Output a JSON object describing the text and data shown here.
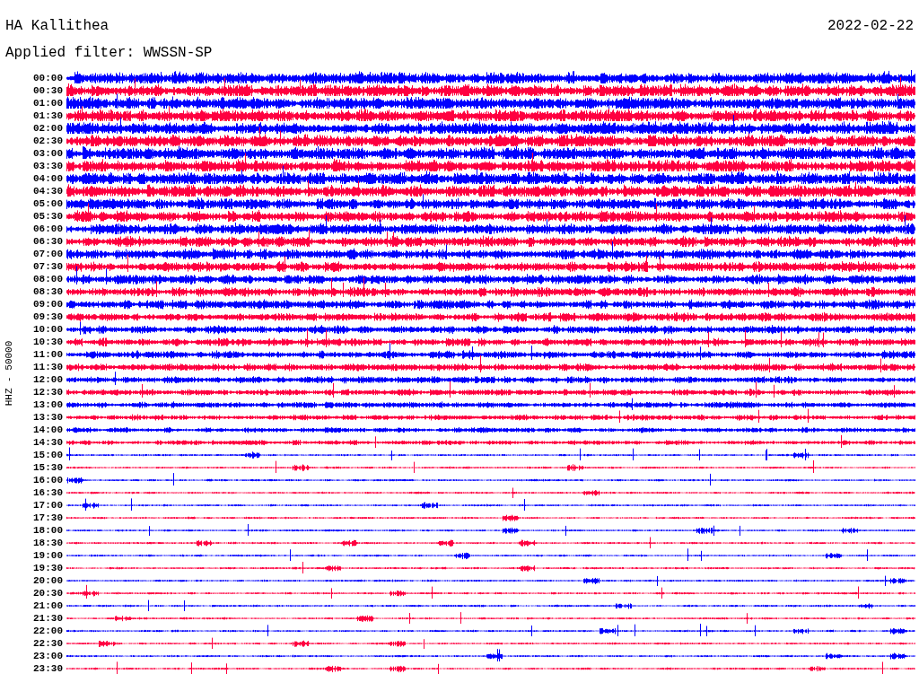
{
  "station": "HA Kallithea",
  "filter": "Applied filter: WWSSN-SP",
  "date": "2022-02-22",
  "channel_label": "HHZ - 50000",
  "rows": [
    {
      "time": "00:00",
      "color": "#0000ff"
    },
    {
      "time": "00:30",
      "color": "#ff0040"
    },
    {
      "time": "01:00",
      "color": "#0000ff"
    },
    {
      "time": "01:30",
      "color": "#ff0040"
    },
    {
      "time": "02:00",
      "color": "#0000ff"
    },
    {
      "time": "02:30",
      "color": "#ff0040"
    },
    {
      "time": "03:00",
      "color": "#0000ff"
    },
    {
      "time": "03:30",
      "color": "#ff0040"
    },
    {
      "time": "04:00",
      "color": "#0000ff"
    },
    {
      "time": "04:30",
      "color": "#ff0040"
    },
    {
      "time": "05:00",
      "color": "#0000ff"
    },
    {
      "time": "05:30",
      "color": "#ff0040"
    },
    {
      "time": "06:00",
      "color": "#0000ff"
    },
    {
      "time": "06:30",
      "color": "#ff0040"
    },
    {
      "time": "07:00",
      "color": "#0000ff"
    },
    {
      "time": "07:30",
      "color": "#ff0040"
    },
    {
      "time": "08:00",
      "color": "#0000ff"
    },
    {
      "time": "08:30",
      "color": "#ff0040"
    },
    {
      "time": "09:00",
      "color": "#0000ff"
    },
    {
      "time": "09:30",
      "color": "#ff0040"
    },
    {
      "time": "10:00",
      "color": "#0000ff"
    },
    {
      "time": "10:30",
      "color": "#ff0040"
    },
    {
      "time": "11:00",
      "color": "#0000ff"
    },
    {
      "time": "11:30",
      "color": "#ff0040"
    },
    {
      "time": "12:00",
      "color": "#0000ff"
    },
    {
      "time": "12:30",
      "color": "#ff0040"
    },
    {
      "time": "13:00",
      "color": "#0000ff"
    },
    {
      "time": "13:30",
      "color": "#ff0040"
    },
    {
      "time": "14:00",
      "color": "#0000ff"
    },
    {
      "time": "14:30",
      "color": "#ff0040"
    },
    {
      "time": "15:00",
      "color": "#0000ff"
    },
    {
      "time": "15:30",
      "color": "#ff0040"
    },
    {
      "time": "16:00",
      "color": "#0000ff"
    },
    {
      "time": "16:30",
      "color": "#ff0040"
    },
    {
      "time": "17:00",
      "color": "#0000ff"
    },
    {
      "time": "17:30",
      "color": "#ff0040"
    },
    {
      "time": "18:00",
      "color": "#0000ff"
    },
    {
      "time": "18:30",
      "color": "#ff0040"
    },
    {
      "time": "19:00",
      "color": "#0000ff"
    },
    {
      "time": "19:30",
      "color": "#ff0040"
    },
    {
      "time": "20:00",
      "color": "#0000ff"
    },
    {
      "time": "20:30",
      "color": "#ff0040"
    },
    {
      "time": "21:00",
      "color": "#0000ff"
    },
    {
      "time": "21:30",
      "color": "#ff0040"
    },
    {
      "time": "22:00",
      "color": "#0000ff"
    },
    {
      "time": "22:30",
      "color": "#ff0040"
    },
    {
      "time": "23:00",
      "color": "#0000ff"
    },
    {
      "time": "23:30",
      "color": "#ff0040"
    }
  ]
}
